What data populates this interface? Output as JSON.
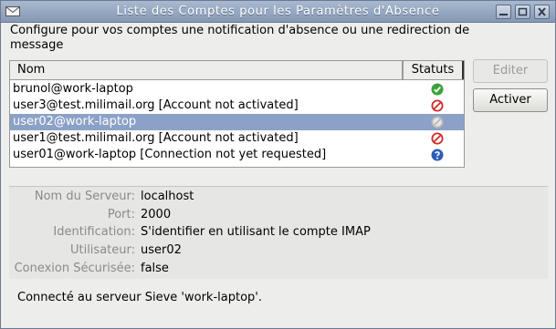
{
  "window": {
    "title": "Liste des Comptes pour les Paramètres d'Absence"
  },
  "intro": {
    "text": "Configure pour vos comptes une notification d'absence ou une redirection de message"
  },
  "accounts_list": {
    "columns": {
      "name": "Nom",
      "status": "Statuts"
    },
    "rows": [
      {
        "name": "brunol@work-laptop",
        "status_icon": "check-icon",
        "status_color": "#3aa33a",
        "selected": false
      },
      {
        "name": "user3@test.milimail.org [Account not activated]",
        "status_icon": "prohibited-icon",
        "status_color": "#d22b2b",
        "selected": false
      },
      {
        "name": "user02@work-laptop",
        "status_icon": "disabled-icon",
        "status_color": "#b9b9b9",
        "selected": true
      },
      {
        "name": "user1@test.milimail.org [Account not activated]",
        "status_icon": "prohibited-icon",
        "status_color": "#d22b2b",
        "selected": false
      },
      {
        "name": "user01@work-laptop [Connection not yet requested]",
        "status_icon": "question-icon",
        "status_color": "#2b5db8",
        "selected": false
      }
    ]
  },
  "buttons": {
    "edit": "Editer",
    "activate": "Activer"
  },
  "details": {
    "server_label": "Nom du Serveur:",
    "server_value": "localhost",
    "port_label": "Port:",
    "port_value": "2000",
    "auth_label": "Identification:",
    "auth_value": "S'identifier en utilisant le compte IMAP",
    "user_label": "Utilisateur:",
    "user_value": "user02",
    "secure_label": "Conexion Sécurisée:",
    "secure_value": "false"
  },
  "status": {
    "text": "Connecté au serveur Sieve 'work-laptop'."
  },
  "colors": {
    "titlebar": "#8fa2bd",
    "selection": "#8ca1c7"
  }
}
